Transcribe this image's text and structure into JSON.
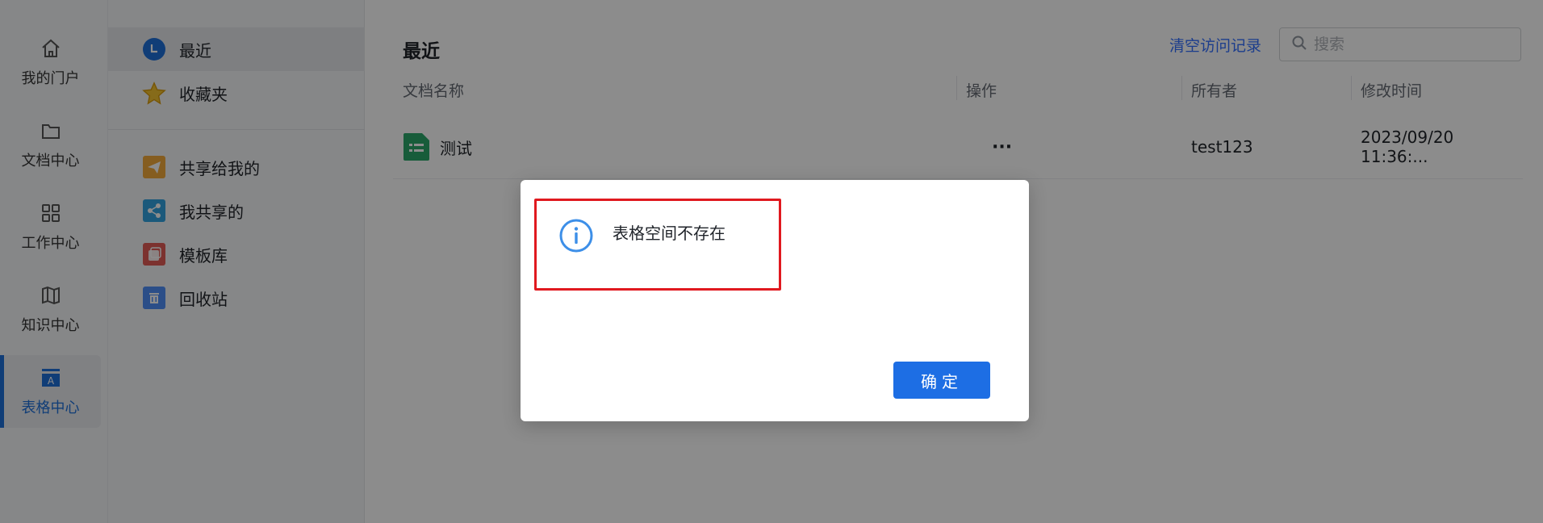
{
  "rail": {
    "items": [
      {
        "label": "我的门户",
        "icon": "home-icon"
      },
      {
        "label": "文档中心",
        "icon": "folder-icon"
      },
      {
        "label": "工作中心",
        "icon": "grid-icon"
      },
      {
        "label": "知识中心",
        "icon": "map-icon"
      },
      {
        "label": "表格中心",
        "icon": "table-icon",
        "active": true
      }
    ]
  },
  "sidebar": {
    "top_items": [
      {
        "label": "最近",
        "icon": "clock-icon",
        "active": true
      },
      {
        "label": "收藏夹",
        "icon": "star-icon"
      }
    ],
    "items": [
      {
        "label": "共享给我的",
        "icon": "send-icon"
      },
      {
        "label": "我共享的",
        "icon": "share-icon"
      },
      {
        "label": "模板库",
        "icon": "template-icon"
      },
      {
        "label": "回收站",
        "icon": "trash-icon"
      }
    ]
  },
  "main": {
    "title": "最近",
    "clear_label": "清空访问记录",
    "search_placeholder": "搜索",
    "columns": [
      "文档名称",
      "操作",
      "所有者",
      "修改时间"
    ],
    "rows": [
      {
        "name": "测试",
        "actions": "···",
        "owner": "test123",
        "modified": "2023/09/20 11:36:..."
      }
    ]
  },
  "dialog": {
    "message": "表格空间不存在",
    "ok_label": "确定"
  },
  "colors": {
    "accent": "#1d6ee4",
    "link": "#3370ff",
    "highlight_border": "#e0191f",
    "info": "#3d8fe8"
  }
}
